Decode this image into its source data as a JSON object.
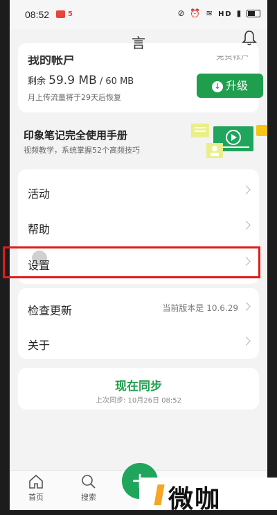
{
  "status_bar": {
    "time": "08:52",
    "notif_badge_text": "5",
    "network": "HD"
  },
  "header": {
    "title": "言"
  },
  "account": {
    "heading": "我的帐户",
    "tier": "免费帐户",
    "quota_prefix": "剩余",
    "quota_used": "59.9 MB",
    "quota_total": "/ 60 MB",
    "quota_note": "月上传流量将于29天后恢复",
    "upgrade_label": "升级"
  },
  "banner": {
    "title": "印象笔记完全使用手册",
    "subtitle": "视频教学，系统掌握52个高频技巧"
  },
  "menu": {
    "activity": "活动",
    "help": "帮助",
    "settings": "设置",
    "check_update": "检查更新",
    "current_version": "当前版本是 10.6.29",
    "about": "关于"
  },
  "sync": {
    "label": "现在同步",
    "last_sync": "上次同步: 10月26日 08:52"
  },
  "bottom_nav": {
    "home": "首页",
    "search": "搜索",
    "fab": "+"
  },
  "watermark": {
    "text": "微咖"
  },
  "colors": {
    "brand_green": "#1f9f4e",
    "highlight_red": "#e01b1b",
    "watermark_orange": "#f5a623"
  }
}
